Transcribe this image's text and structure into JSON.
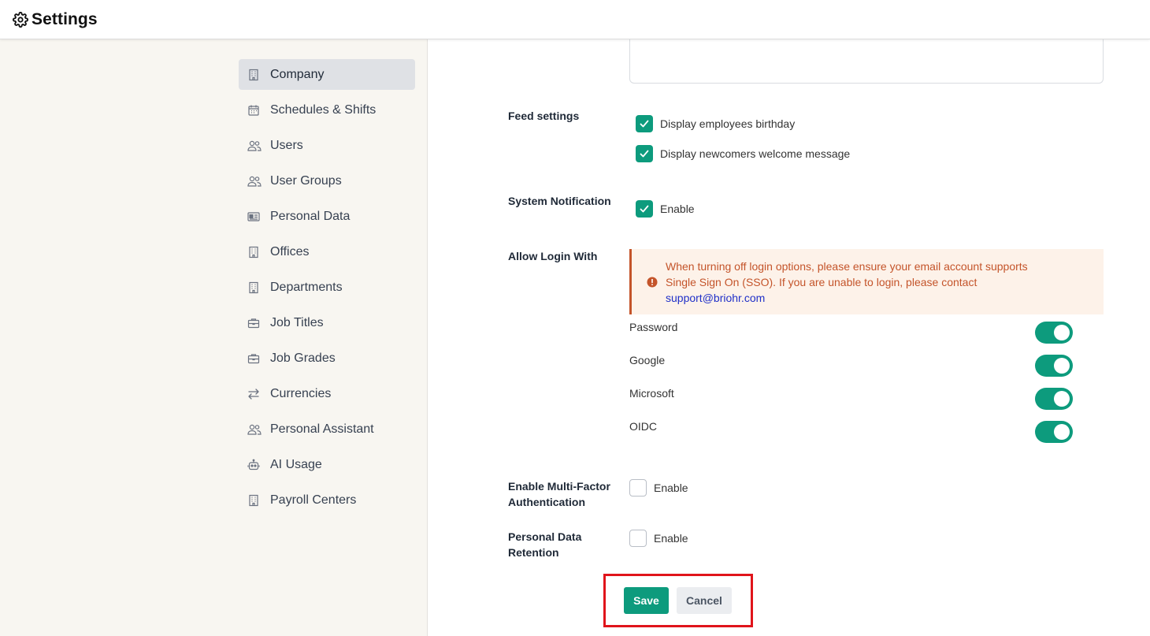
{
  "header": {
    "title": "Settings",
    "icon": "gear-icon"
  },
  "sidebar": {
    "items": [
      {
        "label": "Company",
        "icon": "building-icon",
        "active": true
      },
      {
        "label": "Schedules & Shifts",
        "icon": "calendar-icon",
        "active": false
      },
      {
        "label": "Users",
        "icon": "users-icon",
        "active": false
      },
      {
        "label": "User Groups",
        "icon": "users-icon",
        "active": false
      },
      {
        "label": "Personal Data",
        "icon": "id-card-icon",
        "active": false
      },
      {
        "label": "Offices",
        "icon": "building-icon",
        "active": false
      },
      {
        "label": "Departments",
        "icon": "building-icon",
        "active": false
      },
      {
        "label": "Job Titles",
        "icon": "briefcase-icon",
        "active": false
      },
      {
        "label": "Job Grades",
        "icon": "briefcase-icon",
        "active": false
      },
      {
        "label": "Currencies",
        "icon": "arrows-exchange-icon",
        "active": false
      },
      {
        "label": "Personal Assistant",
        "icon": "users-icon",
        "active": false
      },
      {
        "label": "AI Usage",
        "icon": "robot-icon",
        "active": false
      },
      {
        "label": "Payroll Centers",
        "icon": "building-icon",
        "active": false
      }
    ]
  },
  "main": {
    "feed_settings": {
      "label": "Feed settings",
      "options": [
        {
          "label": "Display employees birthday",
          "checked": true
        },
        {
          "label": "Display newcomers welcome message",
          "checked": true
        }
      ]
    },
    "system_notification": {
      "label": "System Notification",
      "option": "Enable",
      "checked": true
    },
    "allow_login": {
      "label": "Allow Login With",
      "alert_line1": "When turning off login options, please ensure your email account supports",
      "alert_line2": "Single Sign On (SSO). If you are unable to login, please contact",
      "alert_link": "support@briohr.com",
      "options": [
        {
          "label": "Password",
          "enabled": true
        },
        {
          "label": "Google",
          "enabled": true
        },
        {
          "label": "Microsoft",
          "enabled": true
        },
        {
          "label": "OIDC",
          "enabled": true
        }
      ]
    },
    "mfa": {
      "label_line1": "Enable Multi-Factor",
      "label_line2": "Authentication",
      "option": "Enable",
      "checked": false
    },
    "data_retention": {
      "label_line1": "Personal Data",
      "label_line2": "Retention",
      "option": "Enable",
      "checked": false
    },
    "actions": {
      "save_label": "Save",
      "cancel_label": "Cancel"
    }
  },
  "colors": {
    "accent": "#0d9b7d",
    "alert_text": "#c4542a",
    "alert_bg": "#fdf2e9",
    "highlight": "#e0141b"
  }
}
